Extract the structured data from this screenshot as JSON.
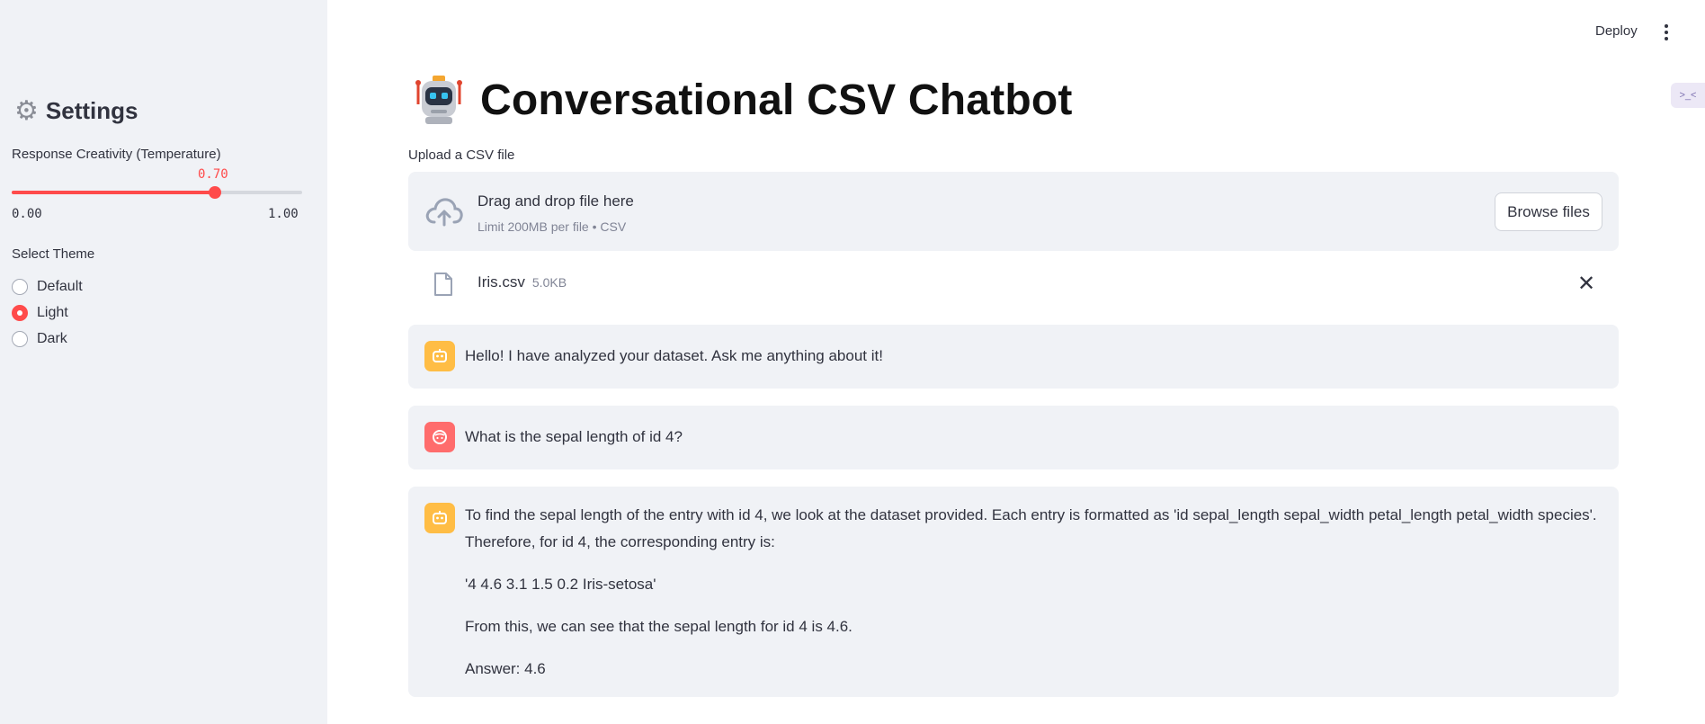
{
  "sidebar": {
    "title": "Settings",
    "icon": "gear-icon",
    "slider": {
      "label": "Response Creativity (Temperature)",
      "value": 0.7,
      "value_text": "0.70",
      "min_text": "0.00",
      "max_text": "1.00",
      "accent": "#ff4b4b"
    },
    "theme": {
      "label": "Select Theme",
      "options": [
        "Default",
        "Light",
        "Dark"
      ],
      "selected": "Light"
    }
  },
  "header": {
    "deploy_label": "Deploy",
    "menu_icon": "kebab-menu-icon"
  },
  "main": {
    "title": "Conversational CSV Chatbot",
    "title_icon": "robot-icon",
    "upload": {
      "label": "Upload a CSV file",
      "drop_text": "Drag and drop file here",
      "limit_text": "Limit 200MB per file • CSV",
      "browse_label": "Browse files"
    },
    "file": {
      "name": "Iris.csv",
      "size": "5.0KB"
    },
    "messages": [
      {
        "role": "assistant",
        "paragraphs": [
          "Hello! I have analyzed your dataset. Ask me anything about it!"
        ]
      },
      {
        "role": "user",
        "paragraphs": [
          "What is the sepal length of id 4?"
        ]
      },
      {
        "role": "assistant",
        "paragraphs": [
          "To find the sepal length of the entry with id 4, we look at the dataset provided. Each entry is formatted as 'id sepal_length sepal_width petal_length petal_width species'. Therefore, for id 4, the corresponding entry is:",
          "'4 4.6 3.1 1.5 0.2 Iris-setosa'",
          "From this, we can see that the sepal length for id 4 is 4.6.",
          "Answer: 4.6"
        ]
      }
    ]
  }
}
